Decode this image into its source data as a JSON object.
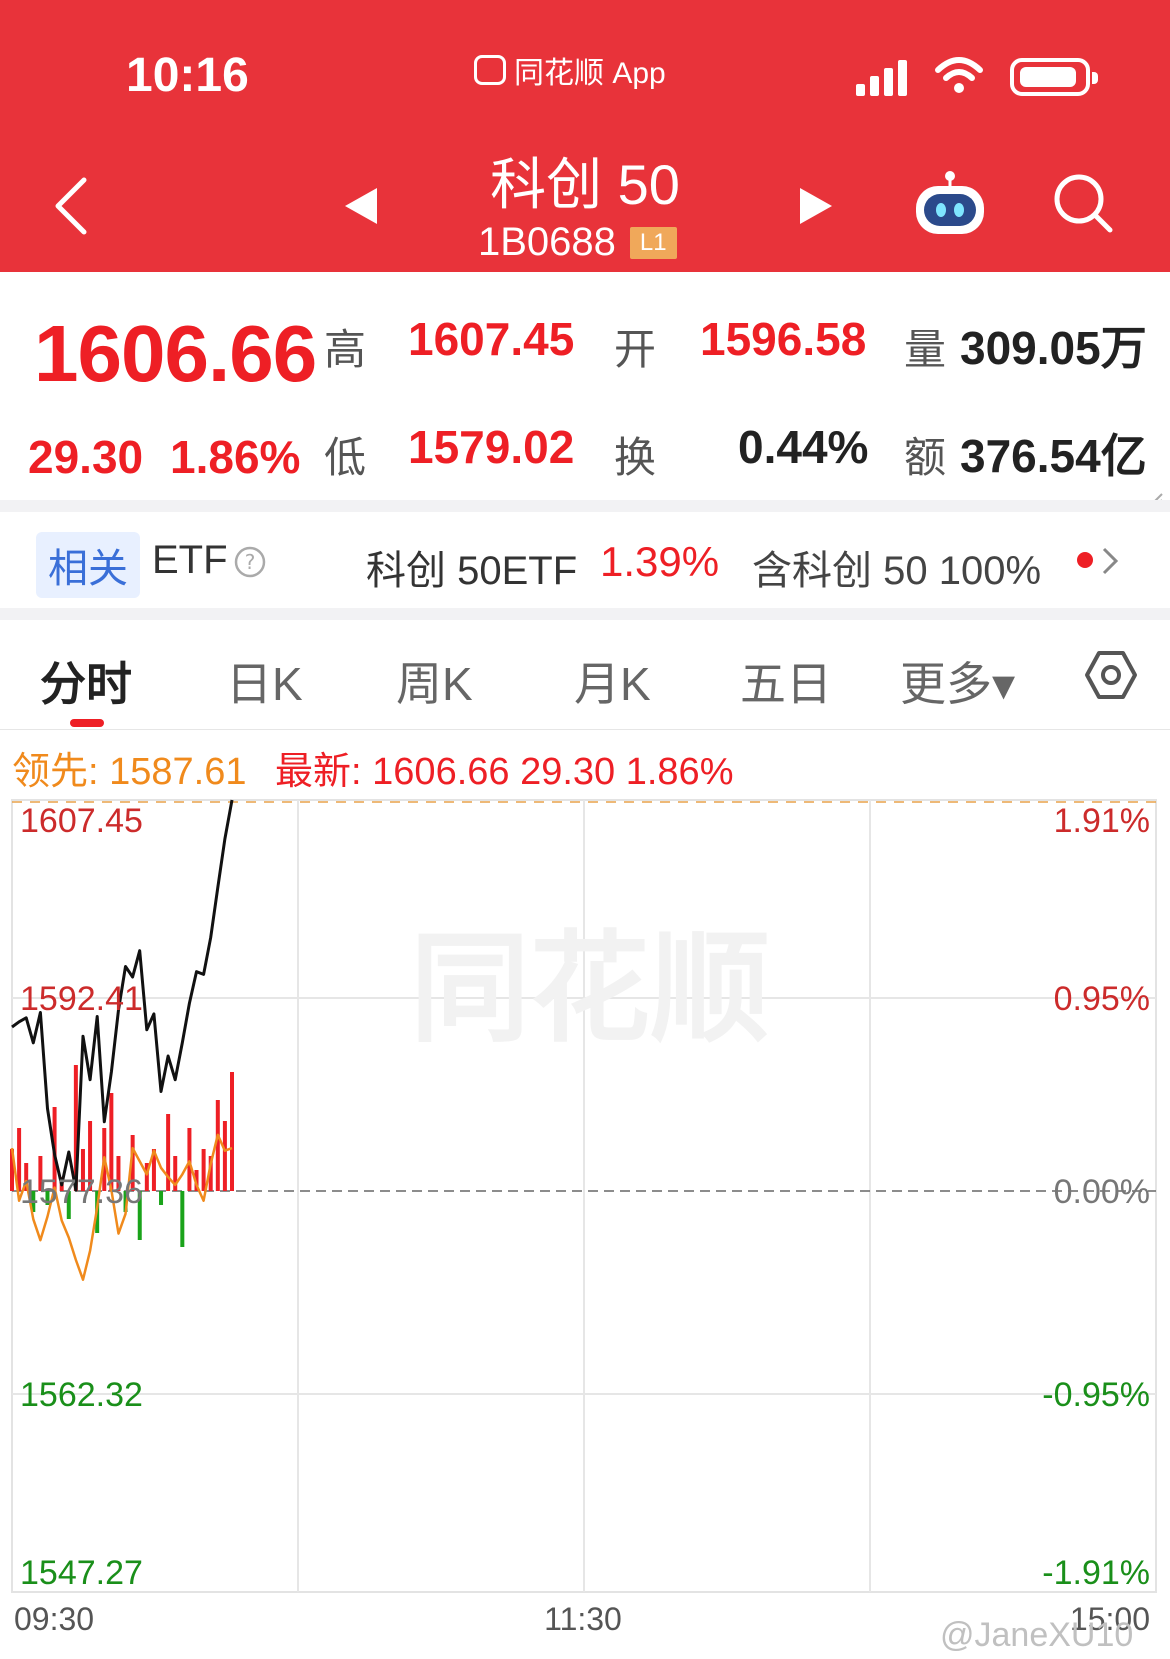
{
  "status": {
    "time": "10:16",
    "app_name": "同花顺 App"
  },
  "header": {
    "title": "科创 50",
    "code": "1B0688",
    "level_badge": "L1"
  },
  "quote": {
    "price": "1606.66",
    "change": "29.30",
    "change_pct": "1.86%",
    "high_label": "高",
    "high": "1607.45",
    "low_label": "低",
    "low": "1579.02",
    "open_label": "开",
    "open": "1596.58",
    "turnover_label": "换",
    "turnover": "0.44%",
    "volume_label": "量",
    "volume": "309.05万",
    "amount_label": "额",
    "amount": "376.54亿"
  },
  "related": {
    "tag": "相关",
    "etf_label": "ETF",
    "etf_name": "科创 50ETF",
    "etf_pct": "1.39%",
    "contains": "含科创 50  100%"
  },
  "tabs": [
    "分时",
    "日K",
    "周K",
    "月K",
    "五日",
    "更多▾"
  ],
  "legend": {
    "lead": "领先: 1587.61",
    "newest": "最新: 1606.66  29.30  1.86%"
  },
  "colors": {
    "brand_red": "#e8333a",
    "up": "#ee1f25",
    "down": "#1aa31a",
    "lead": "#f08a1c"
  },
  "chart_data": {
    "type": "line",
    "y_labels_left": [
      "1607.45",
      "1592.41",
      "1577.36",
      "1562.32",
      "1547.27"
    ],
    "y_labels_right": [
      "1.91%",
      "0.95%",
      "0.00%",
      "-0.95%",
      "-1.91%"
    ],
    "ylim": [
      1547.27,
      1607.45
    ],
    "x_labels": [
      "09:30",
      "11:30",
      "15:00"
    ],
    "series": [
      {
        "name": "最新",
        "color": "#111111",
        "values": [
          1590.2,
          1590.6,
          1590.9,
          1589.0,
          1591.3,
          1584.0,
          1580.5,
          1578.2,
          1580.7,
          1577.8,
          1589.5,
          1586.2,
          1591.0,
          1583.0,
          1586.8,
          1591.5,
          1594.8,
          1594.0,
          1596.0,
          1590.0,
          1591.2,
          1585.3,
          1588.0,
          1586.2,
          1589.0,
          1592.0,
          1594.4,
          1594.2,
          1597.0,
          1600.8,
          1604.5,
          1607.45
        ]
      },
      {
        "name": "领先",
        "color": "#f08a1c",
        "values": [
          1581.0,
          1577.0,
          1578.5,
          1575.6,
          1574.0,
          1575.8,
          1578.0,
          1575.5,
          1574.2,
          1572.5,
          1571.0,
          1573.2,
          1576.5,
          1580.3,
          1577.8,
          1574.5,
          1576.0,
          1581.0,
          1580.0,
          1579.0,
          1580.8,
          1579.5,
          1578.8,
          1578.2,
          1579.0,
          1580.0,
          1578.2,
          1577.0,
          1579.8,
          1582.0,
          1580.8,
          1581.0
        ]
      }
    ],
    "volume": [
      6,
      9,
      4,
      -3,
      5,
      -2,
      12,
      2,
      -4,
      18,
      6,
      10,
      -6,
      9,
      14,
      5,
      -3,
      8,
      -7,
      4,
      6,
      -2,
      11,
      5,
      -8,
      9,
      3,
      6,
      5,
      13,
      10,
      17
    ],
    "grid": true
  }
}
